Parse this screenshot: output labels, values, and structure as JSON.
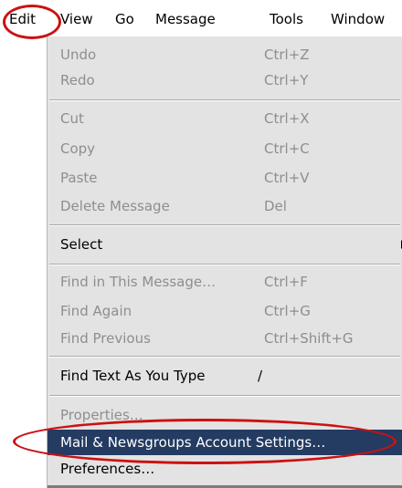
{
  "menubar": {
    "items": [
      "Edit",
      "View",
      "Go",
      "Message",
      "Tools",
      "Window"
    ]
  },
  "edit_menu": {
    "items": [
      {
        "label": "Undo",
        "shortcut": "Ctrl+Z"
      },
      {
        "label": "Redo",
        "shortcut": "Ctrl+Y"
      },
      {
        "label": "Cut",
        "shortcut": "Ctrl+X"
      },
      {
        "label": "Copy",
        "shortcut": "Ctrl+C"
      },
      {
        "label": "Paste",
        "shortcut": "Ctrl+V"
      },
      {
        "label": "Delete Message",
        "shortcut": "Del"
      },
      {
        "label": "Select",
        "shortcut": ""
      },
      {
        "label": "Find in This Message…",
        "shortcut": "Ctrl+F"
      },
      {
        "label": "Find Again",
        "shortcut": "Ctrl+G"
      },
      {
        "label": "Find Previous",
        "shortcut": "Ctrl+Shift+G"
      },
      {
        "label": "Find Text As You Type",
        "shortcut": "/"
      },
      {
        "label": "Properties…",
        "shortcut": ""
      },
      {
        "label": "Mail & Newsgroups Account Settings…",
        "shortcut": ""
      },
      {
        "label": "Preferences…",
        "shortcut": ""
      }
    ]
  },
  "colors": {
    "menu_background": "#e3e3e3",
    "highlight": "#243b62",
    "disabled_text": "#8e8e8e",
    "annotation": "#cc1111"
  }
}
